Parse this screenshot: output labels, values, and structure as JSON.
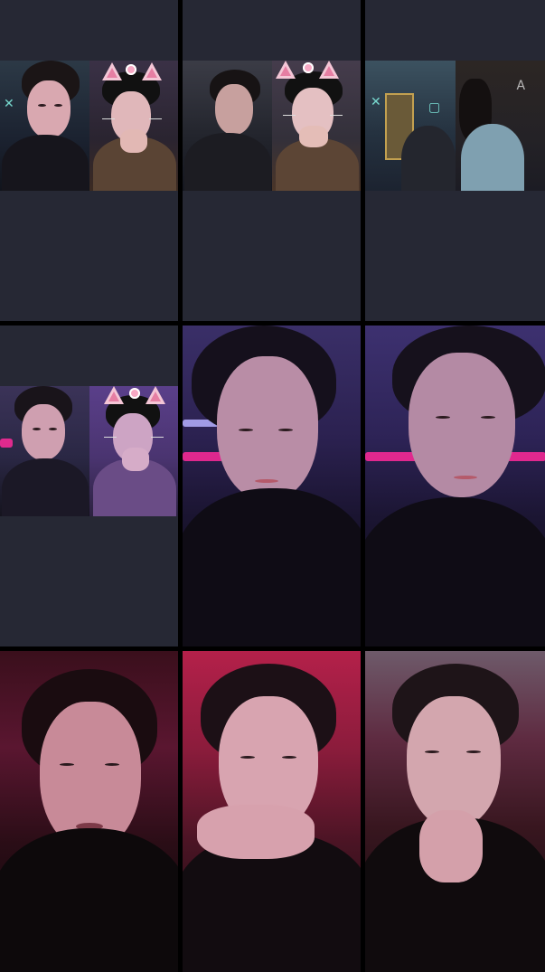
{
  "tiles": [
    {
      "type": "split",
      "left": "man-dark-sweater",
      "right": "woman-cat-filter"
    },
    {
      "type": "split",
      "left": "man-profile",
      "right": "woman-cat-filter"
    },
    {
      "type": "split",
      "left": "arcade-scene",
      "right": "woman-turned-away"
    },
    {
      "type": "split",
      "left": "man-neon",
      "right": "woman-cat-filter-purple"
    },
    {
      "type": "single",
      "subject": "young-man-purple-light"
    },
    {
      "type": "single",
      "subject": "young-man-purple-light"
    },
    {
      "type": "single",
      "subject": "young-man-red-light-talking"
    },
    {
      "type": "single",
      "subject": "young-man-hand-on-chin"
    },
    {
      "type": "single",
      "subject": "young-man-hand-on-chin-looking-up"
    }
  ],
  "colors": {
    "panel": "#262834",
    "neon_cyan": "#8affef",
    "neon_pink": "#ff2a9a",
    "sticker_pink": "#f4c6d6"
  }
}
